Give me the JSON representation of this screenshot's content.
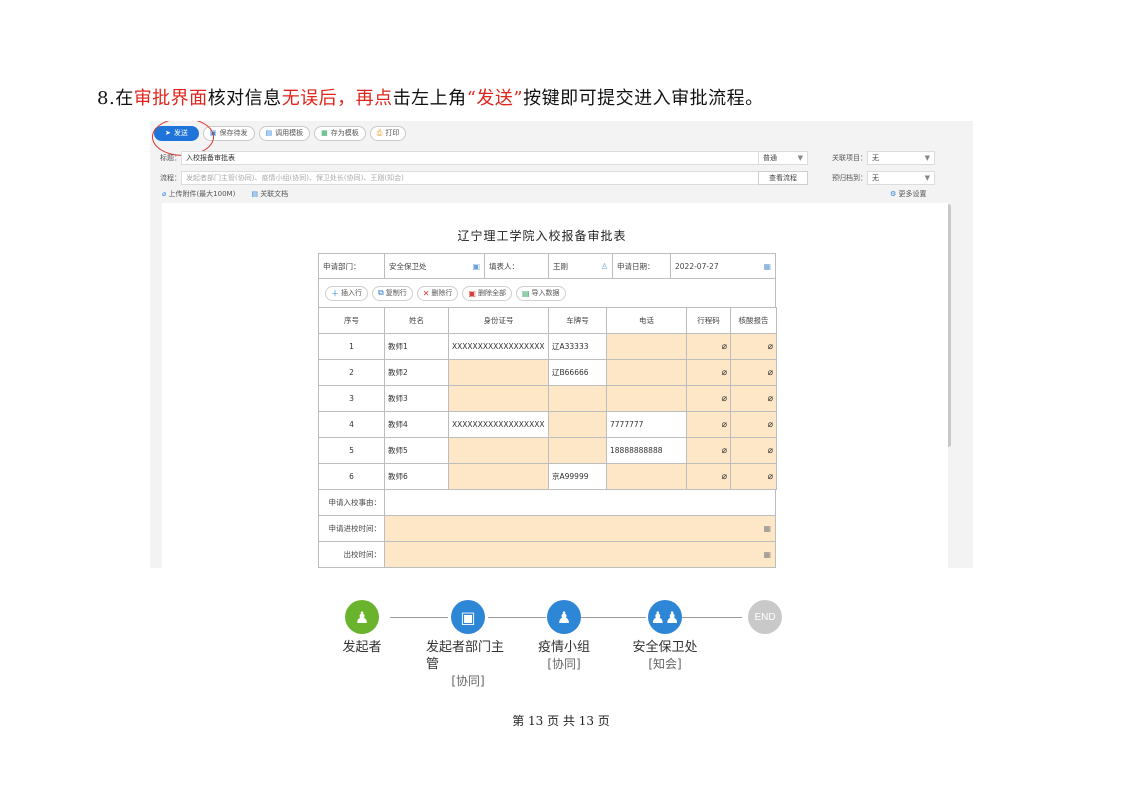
{
  "instruction": {
    "num": "8.",
    "p1": "在",
    "r1": "审批界面",
    "p2": "核对信息",
    "r2": "无误后，再点",
    "p3": "击左上角",
    "r3": "“发送”",
    "p4": "按键即可提交进入审批流程。"
  },
  "toolbar": {
    "send": "发送",
    "save_pending": "保存待发",
    "call_template": "调用模板",
    "save_template": "存为模板",
    "print": "打印"
  },
  "form_header": {
    "title_label": "标题：",
    "title_value": "入校报备审批表",
    "priority": "普通",
    "related_project_label": "关联项目：",
    "related_project_value": "无",
    "flow_label": "流程：",
    "flow_value": "发起者部门主管(协同)、疫情小组(协同)、保卫处长(协同)、王刚(知会)",
    "view_flow": "查看流程",
    "archive_label": "预归档到：",
    "archive_value": "无",
    "upload": "上传附件(最大100M)",
    "related_doc": "关联文档",
    "more_settings": "更多设置"
  },
  "form": {
    "title": "辽宁理工学院入校报备审批表",
    "dept_label": "申请部门：",
    "dept_value": "安全保卫处",
    "filler_label": "填表人：",
    "filler_value": "王刚",
    "date_label": "申请日期：",
    "date_value": "2022-07-27",
    "tools": {
      "insert": "插入行",
      "copy": "复制行",
      "delete": "删除行",
      "delete_all": "删除全部",
      "import": "导入数据"
    },
    "columns": [
      "序号",
      "姓名",
      "身份证号",
      "车牌号",
      "电话",
      "行程码",
      "核酸报告"
    ],
    "rows": [
      {
        "no": "1",
        "name": "教师1",
        "id": "XXXXXXXXXXXXXXXXXX",
        "plate": "辽A33333",
        "phone": ""
      },
      {
        "no": "2",
        "name": "教师2",
        "id": "",
        "plate": "辽B66666",
        "phone": ""
      },
      {
        "no": "3",
        "name": "教师3",
        "id": "",
        "plate": "",
        "phone": ""
      },
      {
        "no": "4",
        "name": "教师4",
        "id": "XXXXXXXXXXXXXXXXXX",
        "plate": "",
        "phone": "7777777"
      },
      {
        "no": "5",
        "name": "教师5",
        "id": "",
        "plate": "",
        "phone": "18888888888"
      },
      {
        "no": "6",
        "name": "教师6",
        "id": "",
        "plate": "京A99999",
        "phone": ""
      }
    ],
    "reason_label": "申请入校事由：",
    "entry_time_label": "申请进校时间：",
    "exit_time_label": "出校时间："
  },
  "workflow": {
    "nodes": [
      {
        "label": "发起者",
        "role": "",
        "color": "#6ab42d"
      },
      {
        "label": "发起者部门主管",
        "role": "[协同]",
        "color": "#2d86d6"
      },
      {
        "label": "疫情小组",
        "role": "[协同]",
        "color": "#2d86d6"
      },
      {
        "label": "安全保卫处",
        "role": "[知会]",
        "color": "#2d86d6"
      },
      {
        "label": "END",
        "role": "",
        "color": "#c9c9c9"
      }
    ]
  },
  "footer": "第 13 页 共 13 页"
}
